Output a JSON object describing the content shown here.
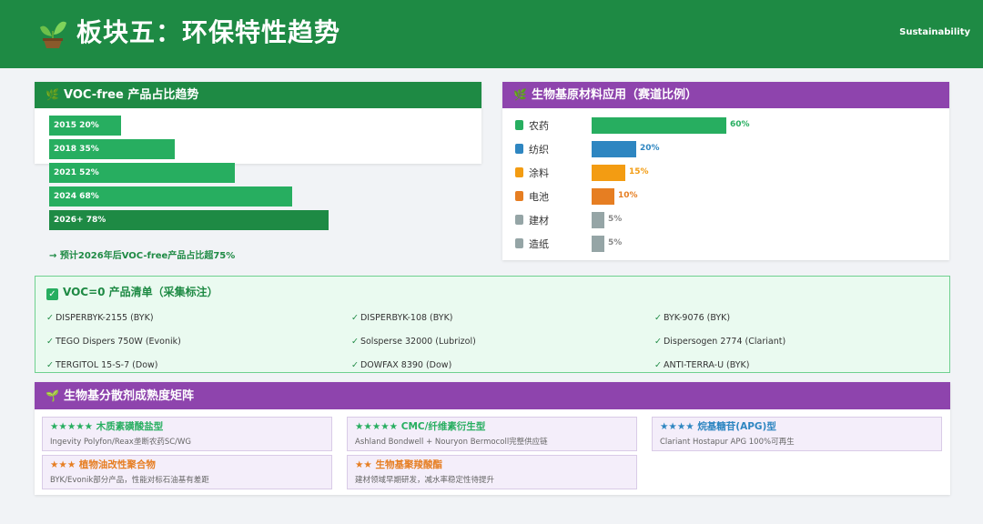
{
  "colors": {
    "header": "#1e8a44",
    "green": "#27ae60",
    "purple": "#8e44ad",
    "blue": "#2e86c1",
    "orange": "#f39c12",
    "dark_orange": "#e67e22",
    "gray": "#95a5a6"
  },
  "header": {
    "icon": "sprout-icon",
    "title": "板块五：环保特性趋势",
    "tag": "Sustainability"
  },
  "voc_card": {
    "icon": "leaf-icon",
    "title": "VOC-free 产品占比趋势",
    "note": "→ 预计2026年后VOC-free产品占比超75%"
  },
  "chart_data": {
    "type": "bar",
    "categories": [
      "2015",
      "2018",
      "2021",
      "2024",
      "2026+"
    ],
    "values": [
      20,
      35,
      52,
      68,
      78
    ],
    "labels": [
      "2015  20%",
      "2018  35%",
      "2021  52%",
      "2024  68%",
      "2026+  78%"
    ],
    "unit": "%",
    "highlight_index": 4
  },
  "bio_card": {
    "icon": "leaf-icon",
    "title": "生物基原材料应用（赛道比例）",
    "rows": [
      {
        "label": "农药",
        "value": 60,
        "text": "60%",
        "color": "#27ae60",
        "icon": "crop-icon"
      },
      {
        "label": "纺织",
        "value": 20,
        "text": "20%",
        "color": "#2e86c1",
        "icon": "textile-icon"
      },
      {
        "label": "涂料",
        "value": 15,
        "text": "15%",
        "color": "#f39c12",
        "icon": "paint-icon"
      },
      {
        "label": "电池",
        "value": 10,
        "text": "10%",
        "color": "#e67e22",
        "icon": "battery-icon"
      },
      {
        "label": "建材",
        "value": 5,
        "text": "5%",
        "color": "#95a5a6",
        "icon": "brick-icon"
      },
      {
        "label": "造纸",
        "value": 5,
        "text": "5%",
        "color": "#95a5a6",
        "icon": "paper-icon"
      }
    ]
  },
  "voc0_list": {
    "icon": "checkbox-icon",
    "title": "VOC=0 产品清单（采集标注）",
    "check": "✓",
    "items": [
      "DISPERBYK-2155 (BYK)",
      "DISPERBYK-108 (BYK)",
      "BYK-9076 (BYK)",
      "TEGO Dispers 750W (Evonik)",
      "Solsperse 32000 (Lubrizol)",
      "Dispersogen 2774 (Clariant)",
      "TERGITOL 15-S-7 (Dow)",
      "DOWFAX 8390 (Dow)",
      "ANTI-TERRA-U (BYK)"
    ]
  },
  "matrix": {
    "icon": "sprout-icon",
    "title": "生物基分散剂成熟度矩阵",
    "cells": [
      {
        "stars": "★★★★★",
        "title": "木质素磺酸盐型",
        "desc": "Ingevity Polyfon/Reax垄断农药SC/WG",
        "color": "#27ae60"
      },
      {
        "stars": "★★★★★",
        "title": "CMC/纤维素衍生型",
        "desc": "Ashland Bondwell + Nouryon Bermocoll完整供应链",
        "color": "#27ae60"
      },
      {
        "stars": "★★★★",
        "title": "烷基糖苷(APG)型",
        "desc": "Clariant Hostapur APG 100%可再生",
        "color": "#2e86c1"
      },
      {
        "stars": "★★★",
        "title": "植物油改性聚合物",
        "desc": "BYK/Evonik部分产品，性能对标石油基有差距",
        "color": "#e67e22"
      },
      {
        "stars": "★★",
        "title": "生物基聚羧酸酯",
        "desc": "建材领域早期研发，减水率稳定性待提升",
        "color": "#e67e22"
      }
    ]
  }
}
